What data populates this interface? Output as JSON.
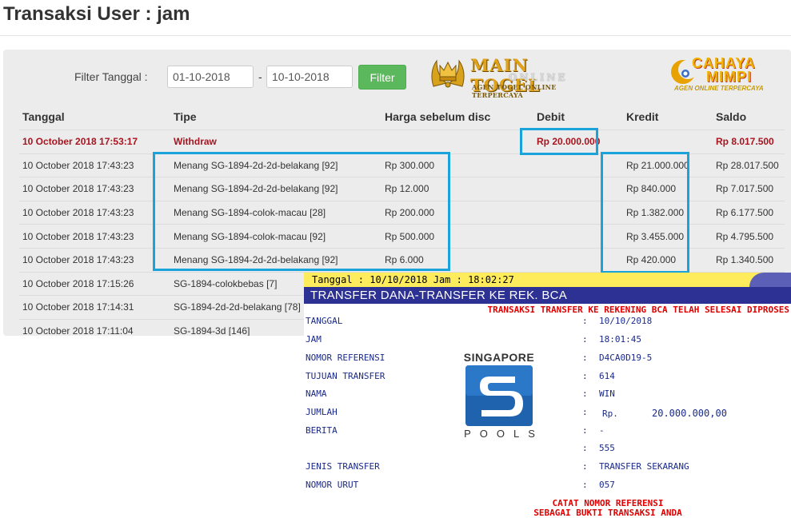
{
  "page": {
    "title": "Transaksi User : jam"
  },
  "filter": {
    "label": "Filter Tanggal :",
    "from": "01-10-2018",
    "separator": "-",
    "to": "10-10-2018",
    "button": "Filter"
  },
  "logos": {
    "main_togel": {
      "name": "MAIN TOGEL",
      "sub": "ONLINE",
      "tagline": "AGEN TOGEL ONLINE TERPERCAYA"
    },
    "cahaya_mimpi": {
      "line1": "CAHAYA",
      "line2": "MIMPI",
      "tagline": "AGEN ONLINE TERPERCAYA"
    }
  },
  "table": {
    "headers": [
      "Tanggal",
      "Tipe",
      "Harga sebelum disc",
      "Debit",
      "Kredit",
      "Saldo"
    ],
    "rows": [
      [
        "10 October 2018 17:53:17",
        "Withdraw",
        "",
        "Rp 20.000.000",
        "",
        "Rp 8.017.500"
      ],
      [
        "10 October 2018 17:43:23",
        "Menang SG-1894-2d-2d-belakang [92]",
        "Rp 300.000",
        "",
        "Rp 21.000.000",
        "Rp 28.017.500"
      ],
      [
        "10 October 2018 17:43:23",
        "Menang SG-1894-2d-2d-belakang [92]",
        "Rp 12.000",
        "",
        "Rp 840.000",
        "Rp 7.017.500"
      ],
      [
        "10 October 2018 17:43:23",
        "Menang SG-1894-colok-macau [28]",
        "Rp 200.000",
        "",
        "Rp 1.382.000",
        "Rp 6.177.500"
      ],
      [
        "10 October 2018 17:43:23",
        "Menang SG-1894-colok-macau [92]",
        "Rp 500.000",
        "",
        "Rp 3.455.000",
        "Rp 4.795.500"
      ],
      [
        "10 October 2018 17:43:23",
        "Menang SG-1894-2d-2d-belakang [92]",
        "Rp 6.000",
        "",
        "Rp 420.000",
        "Rp 1.340.500"
      ],
      [
        "10 October 2018 17:15:26",
        "SG-1894-colokbebas [7]",
        "",
        "",
        "",
        ""
      ],
      [
        "10 October 2018 17:14:31",
        "SG-1894-2d-2d-belakang [78]",
        "",
        "",
        "",
        ""
      ],
      [
        "10 October 2018 17:11:04",
        "SG-1894-3d [146]",
        "",
        "",
        "",
        ""
      ]
    ]
  },
  "receipt": {
    "timestamp": "Tanggal : 10/10/2018 Jam : 18:02:27",
    "title": "TRANSFER DANA-TRANSFER KE REK. BCA",
    "notice": "TRANSAKSI TRANSFER KE REKENING BCA TELAH SELESAI DIPROSES",
    "colon": ":",
    "fields": {
      "tanggal": {
        "label": "TANGGAL",
        "value": "10/10/2018"
      },
      "jam": {
        "label": "JAM",
        "value": "18:01:45"
      },
      "ref": {
        "label": "NOMOR REFERENSI",
        "value": "D4CA0D19-5"
      },
      "tujuan": {
        "label": "TUJUAN TRANSFER",
        "value": "614"
      },
      "nama": {
        "label": "NAMA",
        "value": "WIN"
      },
      "jumlah": {
        "label": "JUMLAH",
        "currency": "Rp.",
        "value": "20.000.000,00"
      },
      "berita": {
        "label": "BERITA",
        "value": "-"
      },
      "extra": {
        "value": "555"
      },
      "jenis": {
        "label": "JENIS TRANSFER",
        "value": "TRANSFER SEKARANG"
      },
      "urut": {
        "label": "NOMOR URUT",
        "value": "057"
      }
    },
    "footer_line1": "CATAT NOMOR REFERENSI",
    "footer_line2": "SEBAGAI BUKTI TRANSAKSI ANDA",
    "logo": {
      "top": "SINGAPORE",
      "bottom": "POOLS"
    }
  },
  "colors": {
    "highlight": "#1aa3db",
    "withdraw_text": "#a8141f",
    "filter_button": "#5cb85c",
    "receipt_bar": "#2c3193",
    "receipt_header": "#ffec5c",
    "receipt_red": "#e00000",
    "receipt_blue": "#1a2a8a"
  }
}
